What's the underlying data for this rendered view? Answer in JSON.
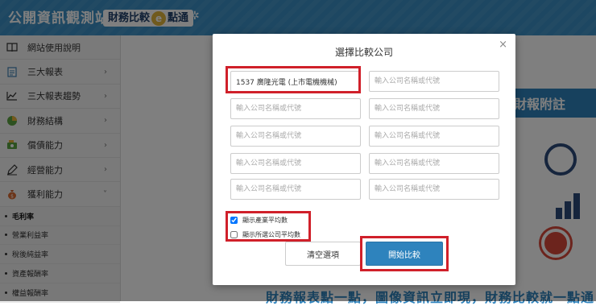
{
  "header": {
    "site_title": "公開資訊觀測站",
    "badge_pre": "財務比較",
    "badge_e": "e",
    "badge_post": "點通",
    "spark": "✲"
  },
  "sidebar": {
    "items": [
      {
        "label": "網站使用說明",
        "icon": "book-icon",
        "has_chevron": false
      },
      {
        "label": "三大報表",
        "icon": "report-icon",
        "has_chevron": true
      },
      {
        "label": "三大報表趨勢",
        "icon": "trend-icon",
        "has_chevron": true
      },
      {
        "label": "財務結構",
        "icon": "pie-icon",
        "has_chevron": true
      },
      {
        "label": "償債能力",
        "icon": "money-icon",
        "has_chevron": true
      },
      {
        "label": "經營能力",
        "icon": "pen-icon",
        "has_chevron": true
      },
      {
        "label": "獲利能力",
        "icon": "moneybag-icon",
        "has_chevron": true
      }
    ],
    "chevron_right": "›",
    "chevron_down": "˅",
    "sub_items": [
      {
        "label": "毛利率",
        "active": true
      },
      {
        "label": "營業利益率",
        "active": false
      },
      {
        "label": "稅後純益率",
        "active": false
      },
      {
        "label": "資產報酬率",
        "active": false
      },
      {
        "label": "權益報酬率",
        "active": false
      }
    ]
  },
  "content": {
    "banner_text": "財報附註",
    "bottom_text": "財務報表點一點，圖像資訊立即現，財務比較就一點通"
  },
  "modal": {
    "title": "選擇比較公司",
    "close": "×",
    "placeholder": "輸入公司名稱或代號",
    "fields": [
      "1537 廣隆光電 (上市電機機械)",
      "",
      "",
      "",
      "",
      "",
      "",
      "",
      "",
      ""
    ],
    "checkboxes": [
      {
        "label": "顯示產業平均數",
        "checked": true
      },
      {
        "label": "顯示所選公司平均數",
        "checked": false
      }
    ],
    "clear_button": "清空選項",
    "start_button": "開始比較"
  },
  "colors": {
    "header_blue": "#3a8fc4",
    "primary_button": "#2e83bd",
    "highlight_red": "#d0202a"
  }
}
